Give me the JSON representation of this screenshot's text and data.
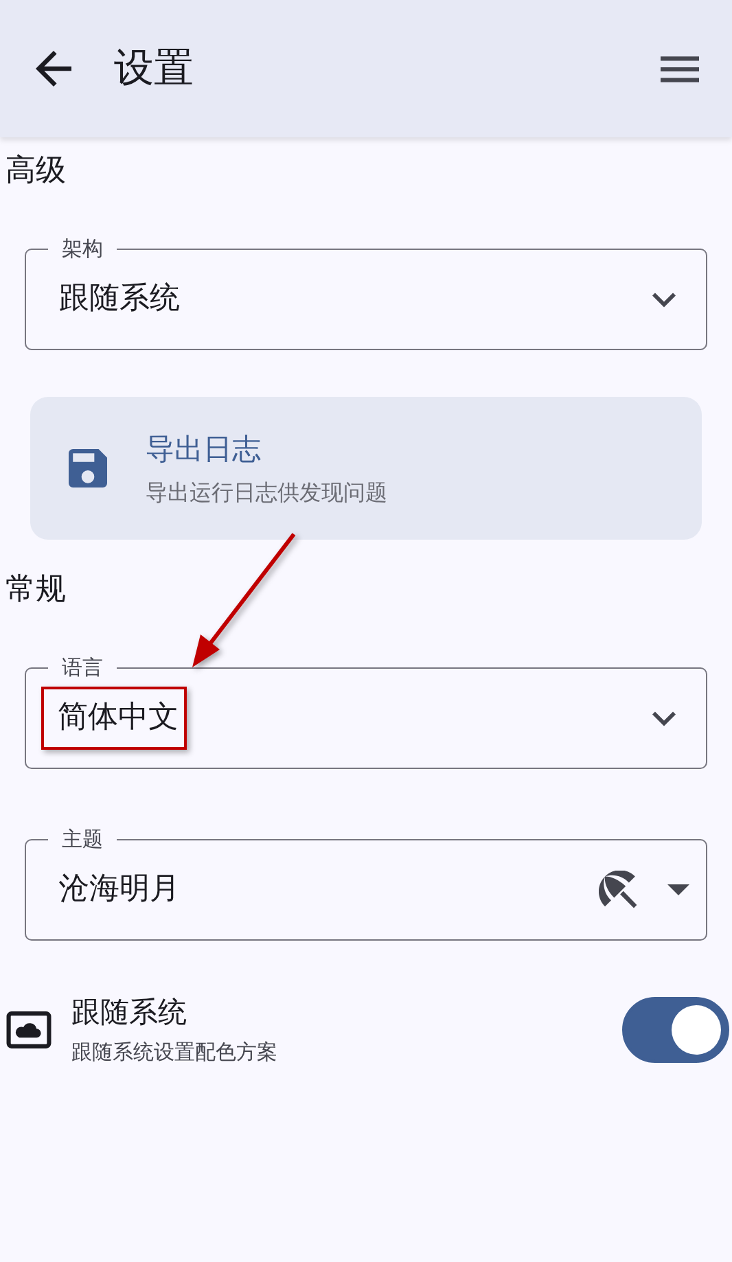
{
  "app_bar": {
    "title": "设置"
  },
  "sections": [
    {
      "title": "高级",
      "items": [
        {
          "kind": "dropdown",
          "label": "架构",
          "value": "跟随系统",
          "highlighted": false
        },
        {
          "kind": "action",
          "title": "导出日志",
          "subtitle": "导出运行日志供发现问题"
        }
      ]
    },
    {
      "title": "常规",
      "items": [
        {
          "kind": "dropdown",
          "label": "语言",
          "value": "简体中文",
          "highlighted": true
        },
        {
          "kind": "theme",
          "label": "主题",
          "value": "沧海明月"
        },
        {
          "kind": "switch",
          "title": "跟随系统",
          "subtitle": "跟随系统设置配色方案",
          "on": true
        }
      ]
    }
  ]
}
